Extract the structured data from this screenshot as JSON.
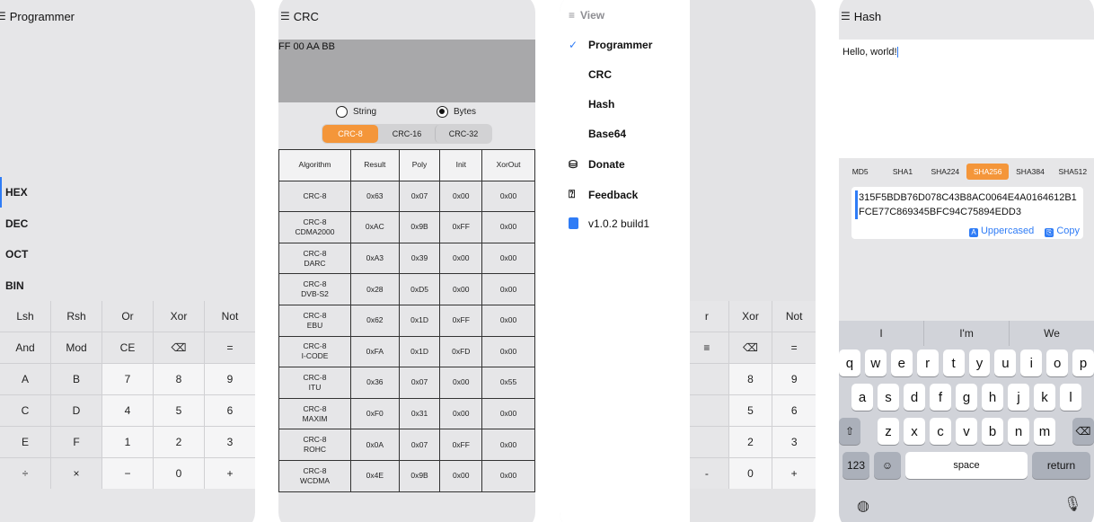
{
  "programmer": {
    "title": "Programmer",
    "radix": [
      "HEX",
      "DEC",
      "OCT",
      "BIN"
    ],
    "keys": [
      "Lsh",
      "Rsh",
      "Or",
      "Xor",
      "Not",
      "And",
      "Mod",
      "CE",
      "⌫",
      "=",
      "A",
      "B",
      "7",
      "8",
      "9",
      "C",
      "D",
      "4",
      "5",
      "6",
      "E",
      "F",
      "1",
      "2",
      "3",
      "÷",
      "×",
      "−",
      "0",
      "+"
    ]
  },
  "crc": {
    "title": "CRC",
    "input": "FF 00 AA BB",
    "mode_string": "String",
    "mode_bytes": "Bytes",
    "tabs": [
      "CRC-8",
      "CRC-16",
      "CRC-32"
    ],
    "headers": [
      "Algorithm",
      "Result",
      "Poly",
      "Init",
      "XorOut"
    ],
    "rows": [
      {
        "name": [
          "CRC-8"
        ],
        "result": "0x63",
        "poly": "0x07",
        "init": "0x00",
        "xorout": "0x00"
      },
      {
        "name": [
          "CRC-8",
          "CDMA2000"
        ],
        "result": "0xAC",
        "poly": "0x9B",
        "init": "0xFF",
        "xorout": "0x00"
      },
      {
        "name": [
          "CRC-8",
          "DARC"
        ],
        "result": "0xA3",
        "poly": "0x39",
        "init": "0x00",
        "xorout": "0x00"
      },
      {
        "name": [
          "CRC-8",
          "DVB-S2"
        ],
        "result": "0x28",
        "poly": "0xD5",
        "init": "0x00",
        "xorout": "0x00"
      },
      {
        "name": [
          "CRC-8",
          "EBU"
        ],
        "result": "0x62",
        "poly": "0x1D",
        "init": "0xFF",
        "xorout": "0x00"
      },
      {
        "name": [
          "CRC-8",
          "I-CODE"
        ],
        "result": "0xFA",
        "poly": "0x1D",
        "init": "0xFD",
        "xorout": "0x00"
      },
      {
        "name": [
          "CRC-8",
          "ITU"
        ],
        "result": "0x36",
        "poly": "0x07",
        "init": "0x00",
        "xorout": "0x55"
      },
      {
        "name": [
          "CRC-8",
          "MAXIM"
        ],
        "result": "0xF0",
        "poly": "0x31",
        "init": "0x00",
        "xorout": "0x00"
      },
      {
        "name": [
          "CRC-8",
          "ROHC"
        ],
        "result": "0x0A",
        "poly": "0x07",
        "init": "0xFF",
        "xorout": "0x00"
      },
      {
        "name": [
          "CRC-8",
          "WCDMA"
        ],
        "result": "0x4E",
        "poly": "0x9B",
        "init": "0x00",
        "xorout": "0x00"
      }
    ]
  },
  "menu": {
    "header": "View",
    "items": [
      "Programmer",
      "CRC",
      "Hash",
      "Base64",
      "Donate",
      "Feedback",
      "v1.0.2 build1"
    ],
    "bg_keys": [
      "r",
      "Xor",
      "Not",
      "≡",
      "⌫",
      "=",
      "",
      "8",
      "9",
      "",
      "5",
      "6",
      "",
      "2",
      "3",
      "-",
      "0",
      "+"
    ]
  },
  "hash": {
    "title": "Hash",
    "input": "Hello, world!",
    "algos": [
      "MD5",
      "SHA1",
      "SHA224",
      "SHA256",
      "SHA384",
      "SHA512"
    ],
    "output": "315F5BDB76D078C43B8AC0064E4A0164612B1FCE77C869345BFC94C75894EDD3",
    "uppercased": "Uppercased",
    "copy": "Copy",
    "suggestions": [
      "I",
      "I'm",
      "We"
    ],
    "row1": [
      "q",
      "w",
      "e",
      "r",
      "t",
      "y",
      "u",
      "i",
      "o",
      "p"
    ],
    "row2": [
      "a",
      "s",
      "d",
      "f",
      "g",
      "h",
      "j",
      "k",
      "l"
    ],
    "row3": [
      "z",
      "x",
      "c",
      "v",
      "b",
      "n",
      "m"
    ],
    "k123": "123",
    "space": "space",
    "return": "return"
  },
  "colors": {
    "accent": "#f4963a",
    "blue": "#2f7cf6"
  }
}
